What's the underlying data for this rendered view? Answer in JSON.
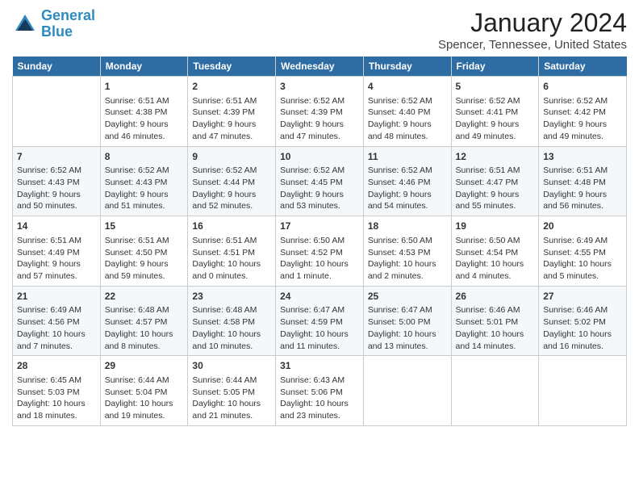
{
  "app": {
    "name": "GeneralBlue",
    "logo_text_part1": "General",
    "logo_text_part2": "Blue"
  },
  "calendar": {
    "title": "January 2024",
    "location": "Spencer, Tennessee, United States",
    "headers": [
      "Sunday",
      "Monday",
      "Tuesday",
      "Wednesday",
      "Thursday",
      "Friday",
      "Saturday"
    ],
    "weeks": [
      [
        {
          "day": "",
          "sunrise": "",
          "sunset": "",
          "daylight": "",
          "empty": true
        },
        {
          "day": "1",
          "sunrise": "Sunrise: 6:51 AM",
          "sunset": "Sunset: 4:38 PM",
          "daylight": "Daylight: 9 hours and 46 minutes."
        },
        {
          "day": "2",
          "sunrise": "Sunrise: 6:51 AM",
          "sunset": "Sunset: 4:39 PM",
          "daylight": "Daylight: 9 hours and 47 minutes."
        },
        {
          "day": "3",
          "sunrise": "Sunrise: 6:52 AM",
          "sunset": "Sunset: 4:39 PM",
          "daylight": "Daylight: 9 hours and 47 minutes."
        },
        {
          "day": "4",
          "sunrise": "Sunrise: 6:52 AM",
          "sunset": "Sunset: 4:40 PM",
          "daylight": "Daylight: 9 hours and 48 minutes."
        },
        {
          "day": "5",
          "sunrise": "Sunrise: 6:52 AM",
          "sunset": "Sunset: 4:41 PM",
          "daylight": "Daylight: 9 hours and 49 minutes."
        },
        {
          "day": "6",
          "sunrise": "Sunrise: 6:52 AM",
          "sunset": "Sunset: 4:42 PM",
          "daylight": "Daylight: 9 hours and 49 minutes."
        }
      ],
      [
        {
          "day": "7",
          "sunrise": "Sunrise: 6:52 AM",
          "sunset": "Sunset: 4:43 PM",
          "daylight": "Daylight: 9 hours and 50 minutes."
        },
        {
          "day": "8",
          "sunrise": "Sunrise: 6:52 AM",
          "sunset": "Sunset: 4:43 PM",
          "daylight": "Daylight: 9 hours and 51 minutes."
        },
        {
          "day": "9",
          "sunrise": "Sunrise: 6:52 AM",
          "sunset": "Sunset: 4:44 PM",
          "daylight": "Daylight: 9 hours and 52 minutes."
        },
        {
          "day": "10",
          "sunrise": "Sunrise: 6:52 AM",
          "sunset": "Sunset: 4:45 PM",
          "daylight": "Daylight: 9 hours and 53 minutes."
        },
        {
          "day": "11",
          "sunrise": "Sunrise: 6:52 AM",
          "sunset": "Sunset: 4:46 PM",
          "daylight": "Daylight: 9 hours and 54 minutes."
        },
        {
          "day": "12",
          "sunrise": "Sunrise: 6:51 AM",
          "sunset": "Sunset: 4:47 PM",
          "daylight": "Daylight: 9 hours and 55 minutes."
        },
        {
          "day": "13",
          "sunrise": "Sunrise: 6:51 AM",
          "sunset": "Sunset: 4:48 PM",
          "daylight": "Daylight: 9 hours and 56 minutes."
        }
      ],
      [
        {
          "day": "14",
          "sunrise": "Sunrise: 6:51 AM",
          "sunset": "Sunset: 4:49 PM",
          "daylight": "Daylight: 9 hours and 57 minutes."
        },
        {
          "day": "15",
          "sunrise": "Sunrise: 6:51 AM",
          "sunset": "Sunset: 4:50 PM",
          "daylight": "Daylight: 9 hours and 59 minutes."
        },
        {
          "day": "16",
          "sunrise": "Sunrise: 6:51 AM",
          "sunset": "Sunset: 4:51 PM",
          "daylight": "Daylight: 10 hours and 0 minutes."
        },
        {
          "day": "17",
          "sunrise": "Sunrise: 6:50 AM",
          "sunset": "Sunset: 4:52 PM",
          "daylight": "Daylight: 10 hours and 1 minute."
        },
        {
          "day": "18",
          "sunrise": "Sunrise: 6:50 AM",
          "sunset": "Sunset: 4:53 PM",
          "daylight": "Daylight: 10 hours and 2 minutes."
        },
        {
          "day": "19",
          "sunrise": "Sunrise: 6:50 AM",
          "sunset": "Sunset: 4:54 PM",
          "daylight": "Daylight: 10 hours and 4 minutes."
        },
        {
          "day": "20",
          "sunrise": "Sunrise: 6:49 AM",
          "sunset": "Sunset: 4:55 PM",
          "daylight": "Daylight: 10 hours and 5 minutes."
        }
      ],
      [
        {
          "day": "21",
          "sunrise": "Sunrise: 6:49 AM",
          "sunset": "Sunset: 4:56 PM",
          "daylight": "Daylight: 10 hours and 7 minutes."
        },
        {
          "day": "22",
          "sunrise": "Sunrise: 6:48 AM",
          "sunset": "Sunset: 4:57 PM",
          "daylight": "Daylight: 10 hours and 8 minutes."
        },
        {
          "day": "23",
          "sunrise": "Sunrise: 6:48 AM",
          "sunset": "Sunset: 4:58 PM",
          "daylight": "Daylight: 10 hours and 10 minutes."
        },
        {
          "day": "24",
          "sunrise": "Sunrise: 6:47 AM",
          "sunset": "Sunset: 4:59 PM",
          "daylight": "Daylight: 10 hours and 11 minutes."
        },
        {
          "day": "25",
          "sunrise": "Sunrise: 6:47 AM",
          "sunset": "Sunset: 5:00 PM",
          "daylight": "Daylight: 10 hours and 13 minutes."
        },
        {
          "day": "26",
          "sunrise": "Sunrise: 6:46 AM",
          "sunset": "Sunset: 5:01 PM",
          "daylight": "Daylight: 10 hours and 14 minutes."
        },
        {
          "day": "27",
          "sunrise": "Sunrise: 6:46 AM",
          "sunset": "Sunset: 5:02 PM",
          "daylight": "Daylight: 10 hours and 16 minutes."
        }
      ],
      [
        {
          "day": "28",
          "sunrise": "Sunrise: 6:45 AM",
          "sunset": "Sunset: 5:03 PM",
          "daylight": "Daylight: 10 hours and 18 minutes."
        },
        {
          "day": "29",
          "sunrise": "Sunrise: 6:44 AM",
          "sunset": "Sunset: 5:04 PM",
          "daylight": "Daylight: 10 hours and 19 minutes."
        },
        {
          "day": "30",
          "sunrise": "Sunrise: 6:44 AM",
          "sunset": "Sunset: 5:05 PM",
          "daylight": "Daylight: 10 hours and 21 minutes."
        },
        {
          "day": "31",
          "sunrise": "Sunrise: 6:43 AM",
          "sunset": "Sunset: 5:06 PM",
          "daylight": "Daylight: 10 hours and 23 minutes."
        },
        {
          "day": "",
          "sunrise": "",
          "sunset": "",
          "daylight": "",
          "empty": true
        },
        {
          "day": "",
          "sunrise": "",
          "sunset": "",
          "daylight": "",
          "empty": true
        },
        {
          "day": "",
          "sunrise": "",
          "sunset": "",
          "daylight": "",
          "empty": true
        }
      ]
    ]
  }
}
